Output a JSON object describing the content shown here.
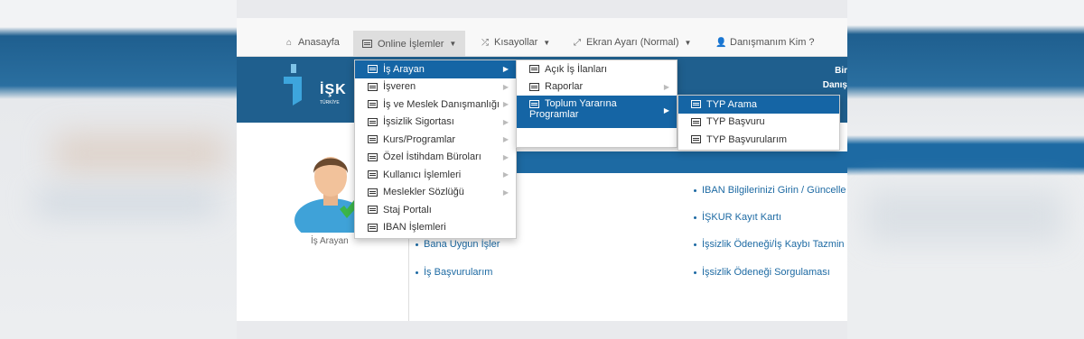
{
  "nav": {
    "home": "Anasayfa",
    "online": "Online İşlemler",
    "shortcuts": "Kısayollar",
    "screen": "Ekran Ayarı (Normal)",
    "advisor": "Danışmanım Kim ?"
  },
  "header": {
    "logo_text": "İŞK",
    "logo_sub": "TÜRKİYE",
    "right_line1": "Bir",
    "right_line2": "Danış"
  },
  "menu1": [
    {
      "label": "İş Arayan",
      "highlighted": true,
      "submenu": true
    },
    {
      "label": "İşveren",
      "submenu": true
    },
    {
      "label": "İş ve Meslek Danışmanlığı",
      "submenu": true
    },
    {
      "label": "İşsizlik Sigortası",
      "submenu": true
    },
    {
      "label": "Kurs/Programlar",
      "submenu": true
    },
    {
      "label": "Özel İstihdam Büroları",
      "submenu": true
    },
    {
      "label": "Kullanıcı İşlemleri",
      "submenu": true
    },
    {
      "label": "Meslekler Sözlüğü",
      "submenu": true
    },
    {
      "label": "Staj Portalı",
      "submenu": false
    },
    {
      "label": "IBAN İşlemleri",
      "submenu": false
    }
  ],
  "menu2": [
    {
      "label": "Açık İş İlanları"
    },
    {
      "label": "Raporlar"
    },
    {
      "label_line1": "Toplum Yararına",
      "label_line2": "Programlar"
    }
  ],
  "menu3": [
    {
      "label": "TYP Arama"
    },
    {
      "label": "TYP Başvuru"
    },
    {
      "label": "TYP Başvurularım"
    }
  ],
  "content": {
    "avatar_label": "İş Arayan",
    "left_links": [
      "Bana Uygun İşler",
      "İş Başvurularım"
    ],
    "right_links": [
      "IBAN Bilgilerinizi Girin / Güncelle",
      "İŞKUR Kayıt Kartı",
      "İşsizlik Ödeneği/İş Kaybı Tazmin",
      "İşsizlik Ödeneği Sorgulaması"
    ]
  },
  "colors": {
    "brand_blue": "#1f5f8e",
    "highlight": "#1565a5",
    "link": "#1d6aa3"
  }
}
